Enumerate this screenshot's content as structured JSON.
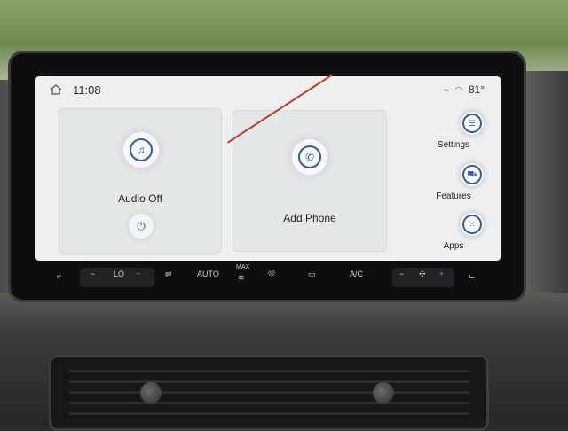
{
  "status": {
    "time": "11:08",
    "temperature": "81°"
  },
  "tiles": {
    "audio": {
      "label": "Audio Off",
      "icon": "music-note-icon"
    },
    "phone": {
      "label": "Add Phone",
      "icon": "phone-icon"
    }
  },
  "side_menu": [
    {
      "label": "Settings",
      "icon": "sliders-icon"
    },
    {
      "label": "Features",
      "icon": "car-icon"
    },
    {
      "label": "Apps",
      "icon": "grid-icon"
    }
  ],
  "climate": {
    "left_temp": "LO",
    "minus": "−",
    "plus": "+",
    "auto": "AUTO",
    "max": "MAX",
    "ac": "A/C"
  },
  "colors": {
    "accent": "#2f5aa8",
    "slash": "#c0392b"
  }
}
